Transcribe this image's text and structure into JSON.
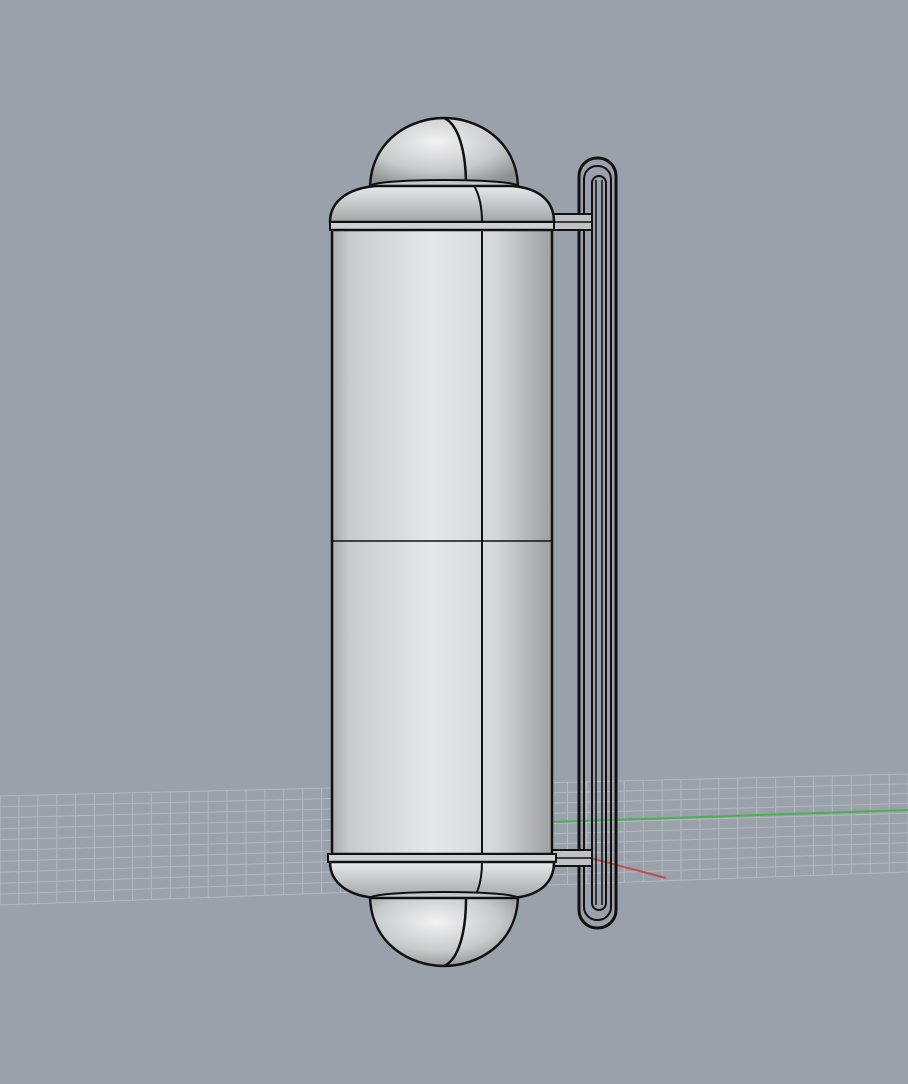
{
  "viewport": {
    "background_color": "#9aa1aa",
    "grid_line_color": "#b3b9c0",
    "x_axis_color": "#c0504d",
    "y_axis_color": "#4caf50",
    "model_fill_color": "#d9dadb",
    "wire_color": "#111111"
  },
  "objects": [
    {
      "semantic": "cylinder-lamp-body"
    },
    {
      "semantic": "top-dome-cap"
    },
    {
      "semantic": "bottom-dome-cap"
    },
    {
      "semantic": "wall-mounting-bracket"
    }
  ]
}
